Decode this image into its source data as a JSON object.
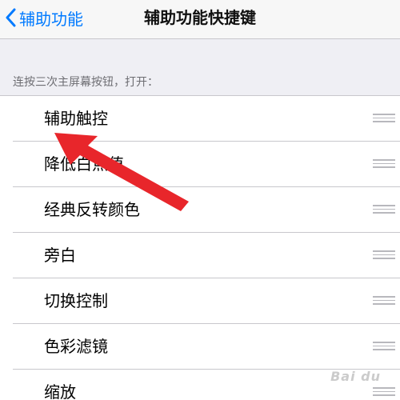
{
  "nav": {
    "back_label": "辅助功能",
    "title": "辅助功能快捷键"
  },
  "section_header": "连按三次主屏幕按钮，打开：",
  "items": [
    {
      "label": "辅助触控"
    },
    {
      "label": "降低白点值"
    },
    {
      "label": "经典反转颜色"
    },
    {
      "label": "旁白"
    },
    {
      "label": "切换控制"
    },
    {
      "label": "色彩滤镜"
    },
    {
      "label": "缩放"
    }
  ],
  "annotation": {
    "color": "#e8262b"
  },
  "watermark": "Bai du",
  "colors": {
    "accent": "#007aff",
    "background": "#efeff4"
  }
}
